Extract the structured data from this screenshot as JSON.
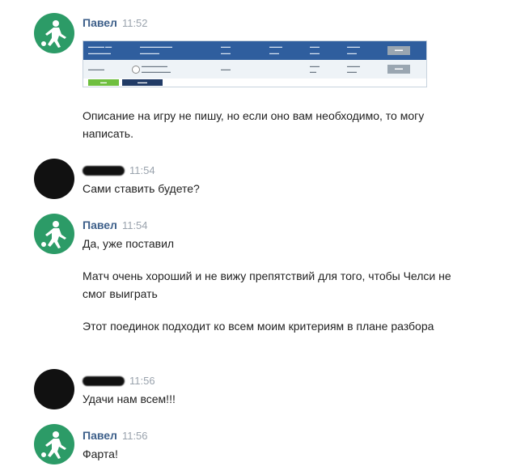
{
  "messages": [
    {
      "author": "Павел",
      "time": "11:52",
      "avatar": "soccer-player-avatar",
      "paragraphs": [
        "Описание на игру не пишу, но если оно вам необходимо, то могу написать."
      ]
    },
    {
      "author": "",
      "time": "11:54",
      "avatar": "blacked-out-avatar",
      "paragraphs": [
        "Сами ставить будете?"
      ]
    },
    {
      "author": "Павел",
      "time": "11:54",
      "avatar": "soccer-player-avatar",
      "paragraphs": [
        "Да, уже поставил",
        "Матч очень хороший и не вижу препятствий для того, чтобы Челси не смог выиграть",
        "Этот поединок подходит ко всем моим критериям в плане разбора"
      ]
    },
    {
      "author": "",
      "time": "11:56",
      "avatar": "blacked-out-avatar",
      "paragraphs": [
        "Удачи нам всем!!!"
      ]
    },
    {
      "author": "Павел",
      "time": "11:56",
      "avatar": "soccer-player-avatar",
      "paragraphs": [
        "Фарта!"
      ]
    }
  ],
  "colors": {
    "avatar_green": "#2c9b67",
    "author_blue": "#3d5f8a",
    "time_gray": "#9aa3ad",
    "shot_header_blue": "#2f5e9e"
  }
}
